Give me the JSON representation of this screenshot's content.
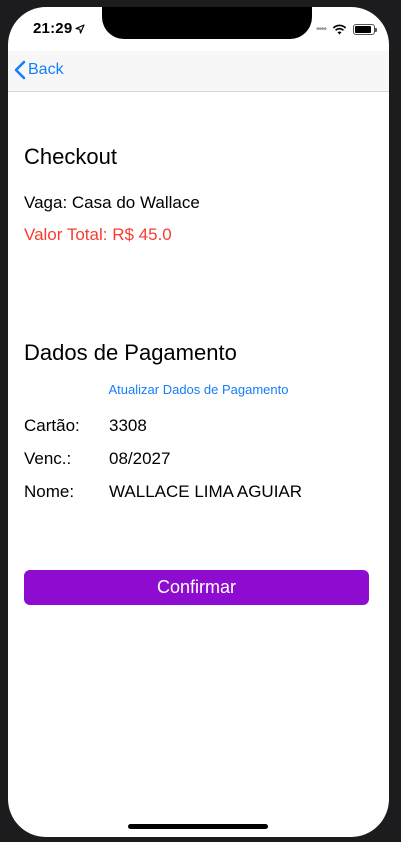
{
  "status_bar": {
    "time": "21:29",
    "icons": [
      "location-arrow-icon",
      "signal-icon",
      "wifi-icon",
      "battery-icon"
    ]
  },
  "nav": {
    "back_label": "Back",
    "back_icon": "chevron-left-icon"
  },
  "checkout": {
    "title": "Checkout",
    "vaga_label": "Vaga:",
    "vaga_value": "Casa do Wallace",
    "total_label": "Valor Total:",
    "total_value": "R$ 45.0"
  },
  "payment": {
    "title": "Dados de Pagamento",
    "update_link": "Atualizar Dados de Pagamento",
    "card_label": "Cartão:",
    "card_value": "3308",
    "expiry_label": "Venc.:",
    "expiry_value": "08/2027",
    "name_label": "Nome:",
    "name_value": "WALLACE LIMA AGUIAR"
  },
  "actions": {
    "confirm_label": "Confirmar"
  },
  "colors": {
    "accent_blue": "#157efb",
    "total_red": "#fb3b30",
    "confirm_purple": "#8e0ccf"
  }
}
